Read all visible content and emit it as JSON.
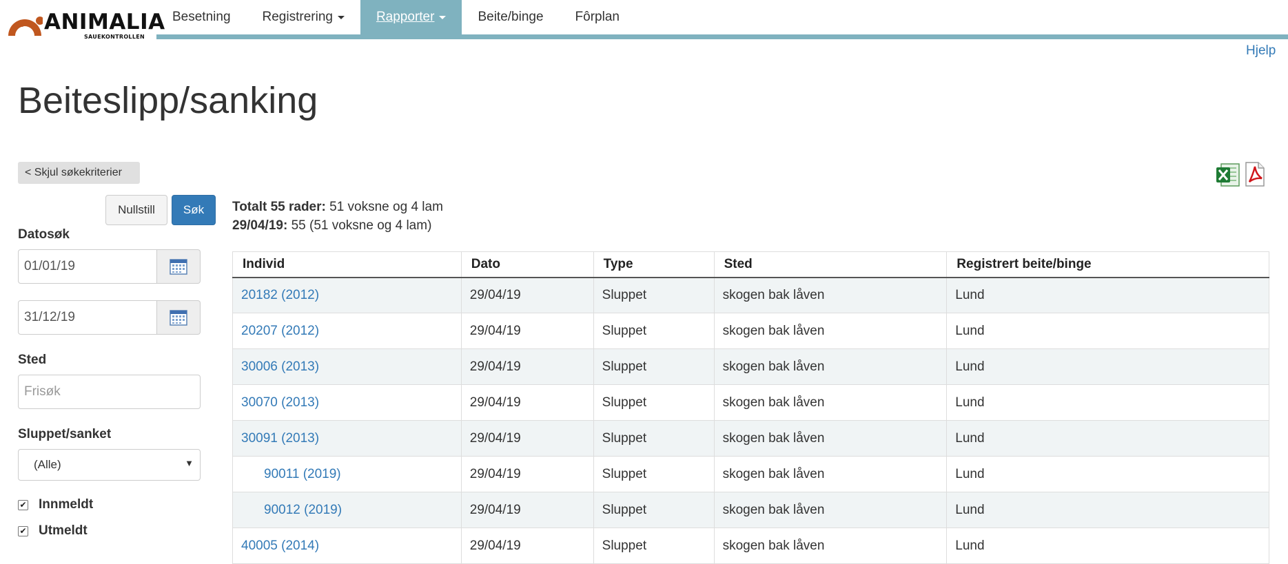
{
  "brand": {
    "name": "ANIMALIA",
    "sub": "SAUEKONTROLLEN",
    "colors": {
      "mark": "#c0571f",
      "nav_accent": "#7fb2bf"
    }
  },
  "nav": [
    {
      "label": "Besetning",
      "dropdown": false
    },
    {
      "label": "Registrering",
      "dropdown": true
    },
    {
      "label": "Rapporter",
      "dropdown": true,
      "active": true
    },
    {
      "label": "Beite/binge",
      "dropdown": false
    },
    {
      "label": "Fôrplan",
      "dropdown": false
    }
  ],
  "help_label": "Hjelp",
  "page_title": "Beiteslipp/sanking",
  "filters": {
    "toggle_label": "< Skjul søkekriterier",
    "reset_label": "Nullstill",
    "search_label": "Søk",
    "date_label": "Datosøk",
    "date_from": "01/01/19",
    "date_to": "31/12/19",
    "place_label": "Sted",
    "place_placeholder": "Frisøk",
    "status_label": "Sluppet/sanket",
    "status_value": "(Alle)",
    "check_in_label": "Innmeldt",
    "check_out_label": "Utmeldt"
  },
  "export": {
    "excel_icon": "excel-icon",
    "pdf_icon": "pdf-icon"
  },
  "summary": {
    "total_label": "Totalt 55 rader:",
    "total_text": " 51 voksne og 4 lam",
    "date_label": "29/04/19:",
    "date_text": " 55 (51 voksne og 4 lam)"
  },
  "table": {
    "headers": [
      "Individ",
      "Dato",
      "Type",
      "Sted",
      "Registrert beite/binge"
    ],
    "rows": [
      {
        "individ": "20182 (2012)",
        "dato": "29/04/19",
        "type": "Sluppet",
        "sted": "skogen bak låven",
        "reg": "Lund"
      },
      {
        "individ": "20207 (2012)",
        "dato": "29/04/19",
        "type": "Sluppet",
        "sted": "skogen bak låven",
        "reg": "Lund"
      },
      {
        "individ": "30006 (2013)",
        "dato": "29/04/19",
        "type": "Sluppet",
        "sted": "skogen bak låven",
        "reg": "Lund"
      },
      {
        "individ": "30070 (2013)",
        "dato": "29/04/19",
        "type": "Sluppet",
        "sted": "skogen bak låven",
        "reg": "Lund"
      },
      {
        "individ": "30091 (2013)",
        "dato": "29/04/19",
        "type": "Sluppet",
        "sted": "skogen bak låven",
        "reg": "Lund"
      },
      {
        "individ": "90011 (2019)",
        "dato": "29/04/19",
        "type": "Sluppet",
        "sted": "skogen bak låven",
        "reg": "Lund",
        "lamb": true
      },
      {
        "individ": "90012 (2019)",
        "dato": "29/04/19",
        "type": "Sluppet",
        "sted": "skogen bak låven",
        "reg": "Lund",
        "lamb": true
      },
      {
        "individ": "40005 (2014)",
        "dato": "29/04/19",
        "type": "Sluppet",
        "sted": "skogen bak låven",
        "reg": "Lund"
      }
    ]
  }
}
